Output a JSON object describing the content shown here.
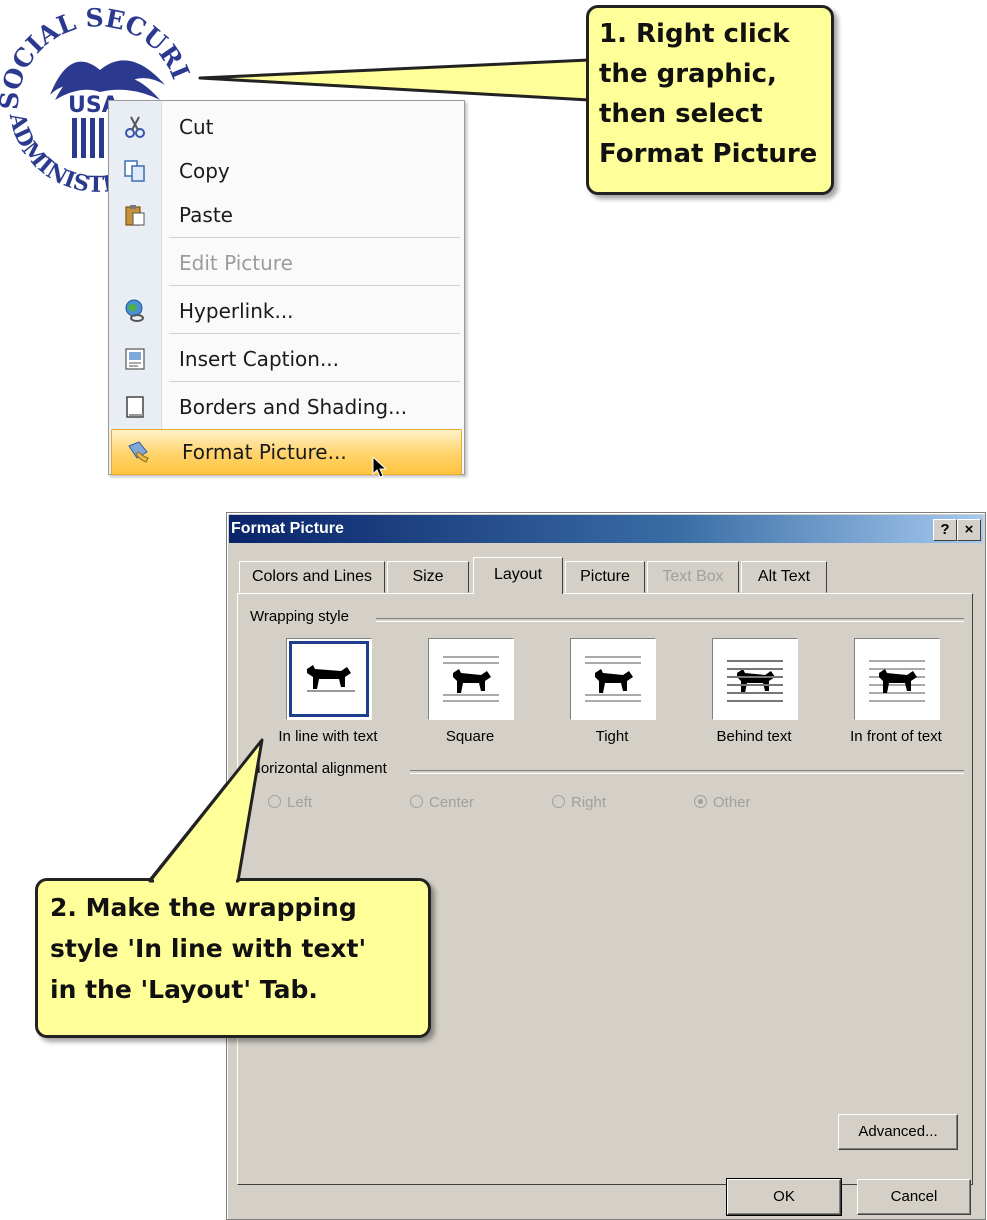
{
  "logo": {
    "arc_text": "SOCIAL SECURITY",
    "center_text": "USA",
    "bottom_text": "ADMINISTRATION"
  },
  "context_menu": {
    "items": [
      {
        "label": "Cut",
        "icon": "scissors-icon",
        "enabled": true
      },
      {
        "label": "Copy",
        "icon": "copy-icon",
        "enabled": true
      },
      {
        "label": "Paste",
        "icon": "clipboard-icon",
        "enabled": true
      },
      {
        "label": "Edit Picture",
        "icon": "",
        "enabled": false
      },
      {
        "label": "Hyperlink...",
        "icon": "hyperlink-globe-icon",
        "enabled": true
      },
      {
        "label": "Insert Caption...",
        "icon": "caption-icon",
        "enabled": true
      },
      {
        "label": "Borders and Shading...",
        "icon": "page-icon",
        "enabled": true
      },
      {
        "label": "Format Picture...",
        "icon": "format-picture-icon",
        "enabled": true,
        "highlighted": true
      }
    ]
  },
  "callout_1": {
    "lines": [
      "1. Right click",
      "the graphic,",
      "then select",
      "Format Picture"
    ]
  },
  "callout_2": {
    "lines": [
      "2. Make the wrapping",
      "style 'In line with text'",
      "in the 'Layout' Tab."
    ]
  },
  "dialog": {
    "title": "Format Picture",
    "help_label": "?",
    "close_label": "×",
    "tabs": [
      {
        "label": "Colors and Lines",
        "active": false,
        "enabled": true
      },
      {
        "label": "Size",
        "active": false,
        "enabled": true
      },
      {
        "label": "Layout",
        "active": true,
        "enabled": true
      },
      {
        "label": "Picture",
        "active": false,
        "enabled": true
      },
      {
        "label": "Text Box",
        "active": false,
        "enabled": false
      },
      {
        "label": "Alt Text",
        "active": false,
        "enabled": true
      }
    ],
    "wrapping_style_label": "Wrapping style",
    "wrapping_options": [
      {
        "label": "In line with text",
        "selected": true
      },
      {
        "label": "Square",
        "selected": false
      },
      {
        "label": "Tight",
        "selected": false
      },
      {
        "label": "Behind text",
        "selected": false
      },
      {
        "label": "In front of text",
        "selected": false
      }
    ],
    "horizontal_alignment_label": "Horizontal alignment",
    "alignment_options": [
      {
        "label": "Left",
        "checked": false
      },
      {
        "label": "Center",
        "checked": false
      },
      {
        "label": "Right",
        "checked": false
      },
      {
        "label": "Other",
        "checked": true
      }
    ],
    "advanced_label": "Advanced...",
    "ok_label": "OK",
    "cancel_label": "Cancel"
  },
  "colors": {
    "callout_fill": "#ffff99",
    "menu_highlight": "#ffd36b",
    "title_bar": "#0a246a",
    "dialog_face": "#d4d0c8",
    "logo_blue": "#2b3a8f"
  }
}
